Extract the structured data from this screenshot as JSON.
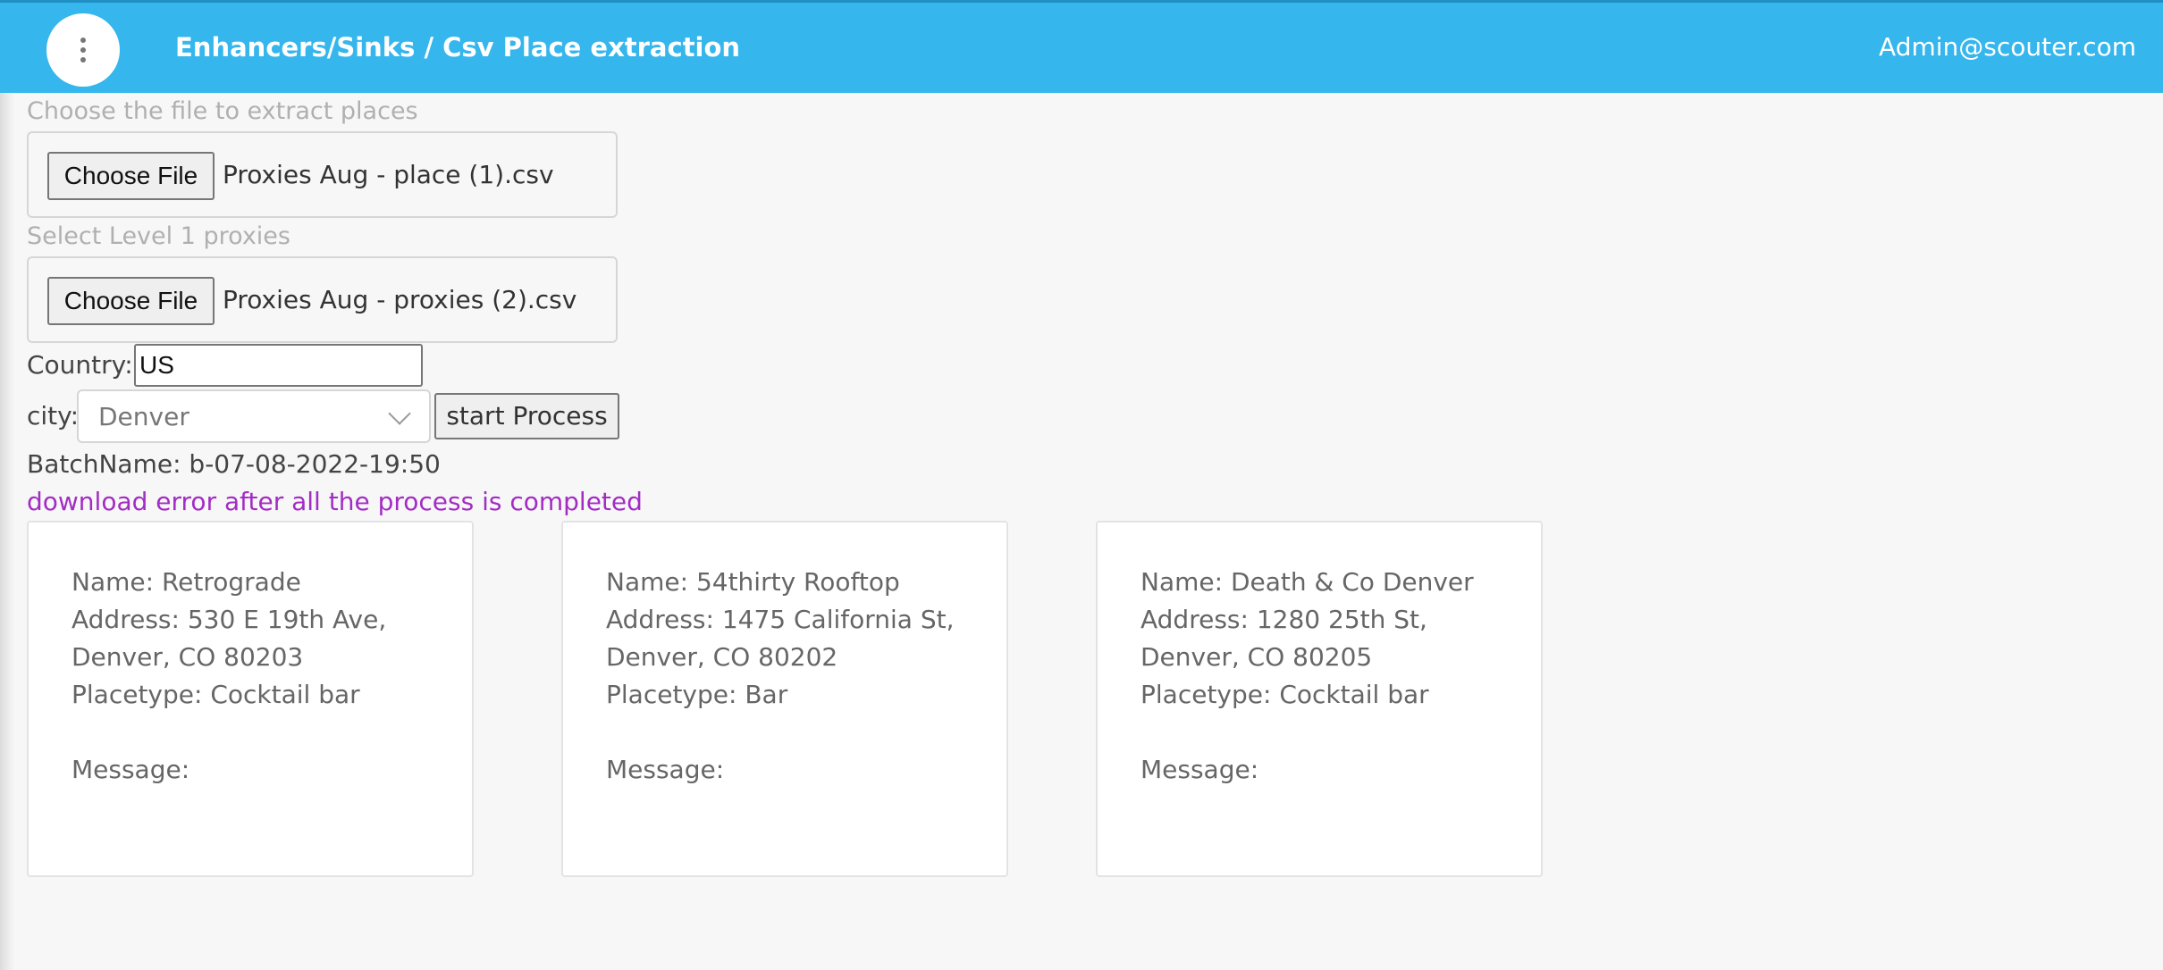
{
  "header": {
    "breadcrumb": "Enhancers/Sinks / Csv Place extraction",
    "user": "Admin@scouter.com"
  },
  "places_file": {
    "label": "Choose the file to extract places",
    "button": "Choose File",
    "filename": "Proxies Aug  - place (1).csv"
  },
  "proxies_file": {
    "label": "Select Level 1 proxies",
    "button": "Choose File",
    "filename": "Proxies Aug  - proxies (2).csv"
  },
  "country": {
    "label": "Country:",
    "value": "US"
  },
  "city": {
    "label": "city:",
    "value": "Denver"
  },
  "start_button": "start Process",
  "batch_name": "BatchName: b-07-08-2022-19:50",
  "warning": "download error after all the process is completed",
  "cards": [
    {
      "name": "Name: Retrograde",
      "address1": "Address: 530 E 19th Ave,",
      "address2": "Denver, CO 80203",
      "placetype": "Placetype: Cocktail bar",
      "message": "Message:"
    },
    {
      "name": "Name: 54thirty Rooftop",
      "address1": "Address: 1475 California St,",
      "address2": "Denver, CO 80202",
      "placetype": "Placetype: Bar",
      "message": "Message:"
    },
    {
      "name": "Name: Death & Co Denver",
      "address1": "Address: 1280 25th St,",
      "address2": "Denver, CO 80205",
      "placetype": "Placetype: Cocktail bar",
      "message": "Message:"
    }
  ],
  "colors": {
    "header_bg": "#35b6ec",
    "warning": "#a32cc4"
  }
}
